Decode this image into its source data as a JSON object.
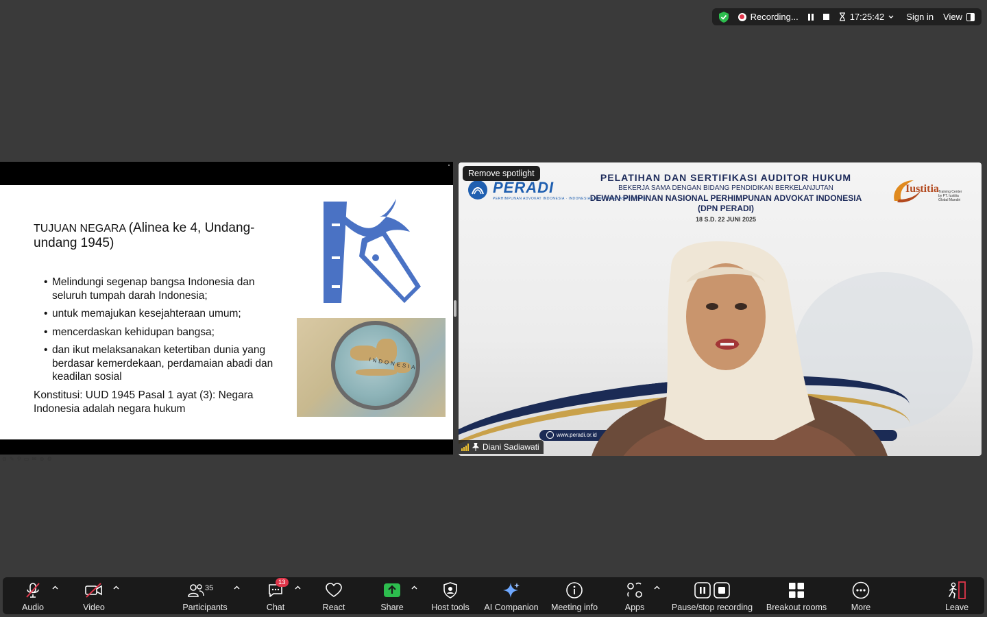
{
  "topbar": {
    "recording_label": "Recording...",
    "time": "17:25:42",
    "sign_in": "Sign in",
    "view": "View"
  },
  "slide": {
    "title_part1": "TUJUAN NEGARA ",
    "title_part2": "(Alinea ke 4, Undang-undang 1945)",
    "bullets": [
      "Melindungi segenap bangsa Indonesia dan seluruh tumpah darah Indonesia;",
      "untuk memajukan kesejahteraan umum;",
      "mencerdaskan kehidupan bangsa;",
      "dan ikut melaksanakan ketertiban dunia yang berdasar kemerdekaan, perdamaian abadi dan keadilan sosial"
    ],
    "konstitusi": "Konstitusi: UUD 1945 Pasal 1 ayat (3): Negara Indonesia adalah negara hukum",
    "map_label": "INDONESIA"
  },
  "video": {
    "spotlight_button": "Remove spotlight",
    "peradi_word": "PERADI",
    "peradi_sub": "PERHIMPUNAN ADVOKAT INDONESIA · INDONESIAN ADVOCATES ASSOCIATION",
    "banner_line1": "PELATIHAN DAN SERTIFIKASI AUDITOR HUKUM",
    "banner_line2": "BEKERJA SAMA DENGAN BIDANG PENDIDIKAN BERKELANJUTAN",
    "banner_line3": "DEWAN PIMPINAN NASIONAL PERHIMPUNAN ADVOKAT INDONESIA",
    "banner_line4": "(DPN PERADI)",
    "banner_line5": "18 S.D. 22 JUNI 2025",
    "iustitia_word": "Iustitia",
    "iustitia_sub": "Training Center by PT. Iustitia Global Mandiri",
    "website": "www.peradi.or.id",
    "participant_name": "Diani Sadiawati"
  },
  "toolbar": {
    "audio": "Audio",
    "video": "Video",
    "participants": "Participants",
    "participants_count": "35",
    "chat": "Chat",
    "chat_badge": "13",
    "react": "React",
    "share": "Share",
    "host_tools": "Host tools",
    "ai_companion": "AI Companion",
    "meeting_info": "Meeting info",
    "apps": "Apps",
    "pause_stop_recording": "Pause/stop recording",
    "breakout_rooms": "Breakout rooms",
    "more": "More",
    "leave": "Leave"
  },
  "colors": {
    "background": "#3a3a3a",
    "toolbar": "#1a1a1a",
    "recording_red": "#e0364b",
    "share_green": "#2dbd4e",
    "k_logo_blue": "#4a72c4",
    "peradi_blue": "#1f5fb0"
  }
}
